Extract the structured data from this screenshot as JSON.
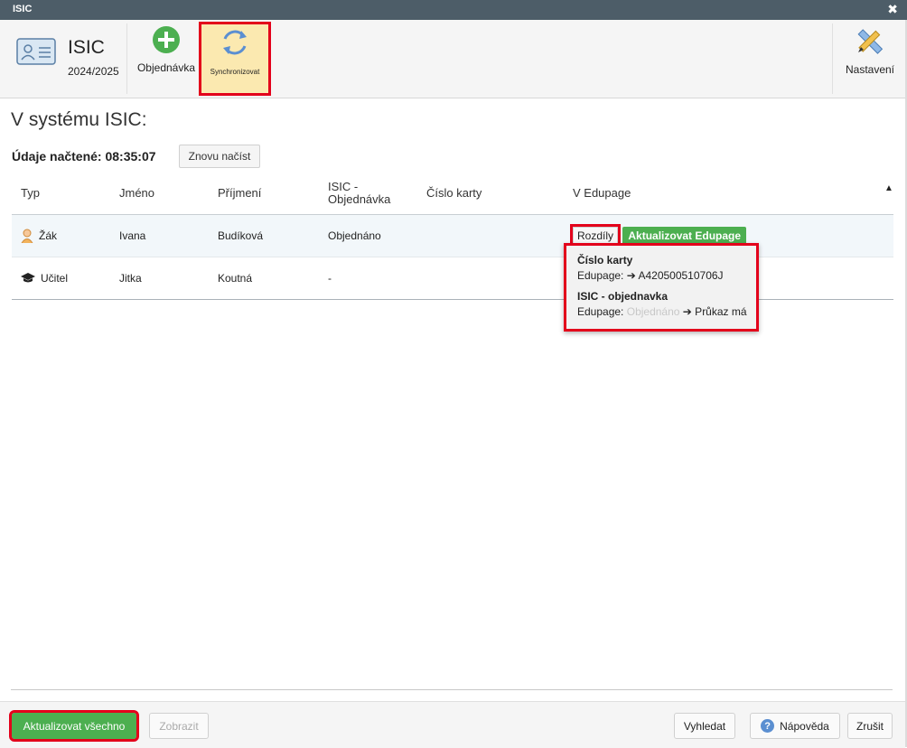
{
  "window": {
    "title": "ISIC"
  },
  "toolbar": {
    "app_title": "ISIC",
    "app_year": "2024/2025",
    "order_label": "Objednávka",
    "sync_label": "Synchronizovat",
    "settings_label": "Nastavení"
  },
  "main": {
    "heading": "V systému ISIC:",
    "loaded_label": "Údaje načtené: 08:35:07",
    "reload_label": "Znovu načíst"
  },
  "table": {
    "headers": {
      "typ": "Typ",
      "jmeno": "Jméno",
      "prijmeni": "Příjmení",
      "isic1": "ISIC -",
      "isic2": "Objednávka",
      "cislo": "Číslo karty",
      "edupage": "V Edupage"
    },
    "sort_indicator": "▲",
    "rows": [
      {
        "typ": "Žák",
        "jmeno": "Ivana",
        "prijmeni": "Budíková",
        "isic": "Objednáno",
        "cislo": "",
        "diff_label": "Rozdíly",
        "update_label": "Aktualizovat Edupage"
      },
      {
        "typ": "Učitel",
        "jmeno": "Jitka",
        "prijmeni": "Koutná",
        "isic": "-",
        "cislo": ""
      }
    ]
  },
  "popup": {
    "title1": "Číslo karty",
    "line1_prefix": "Edupage:",
    "line1_value": "➔ A420500510706J",
    "title2": "ISIC - objednavka",
    "line2_prefix": "Edupage:",
    "line2_old": "Objednáno",
    "line2_value": "➔ Průkaz má"
  },
  "footer": {
    "update_all": "Aktualizovat všechno",
    "show": "Zobrazit",
    "search": "Vyhledat",
    "help": "Nápověda",
    "help_icon": "?",
    "cancel": "Zrušit"
  },
  "colors": {
    "accent_green": "#4caf50",
    "highlight_red": "#e3001b",
    "titlebar": "#4d5d68"
  }
}
